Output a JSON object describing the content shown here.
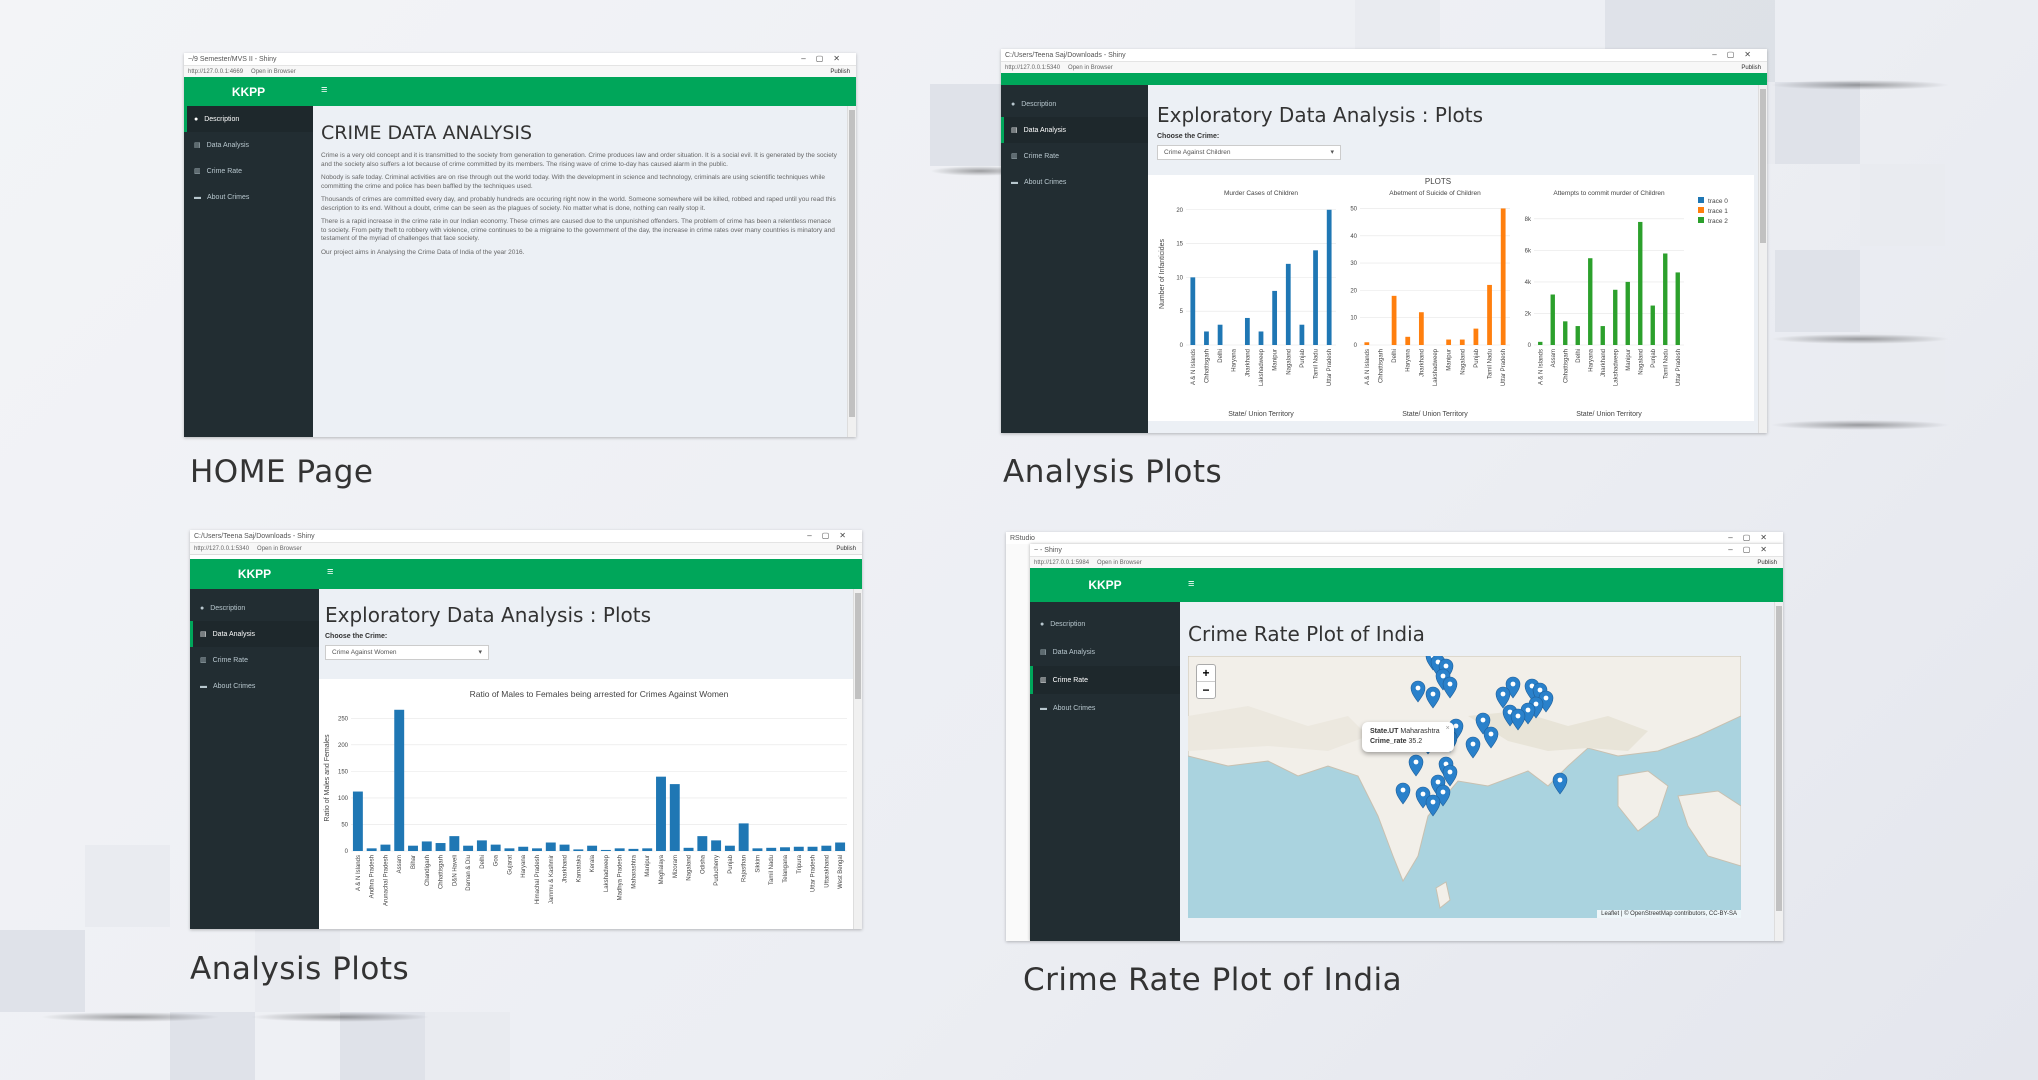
{
  "captions": {
    "home": "HOME Page",
    "analysis1": "Analysis Plots",
    "analysis2": "Analysis Plots",
    "map": "Crime Rate Plot of India"
  },
  "common": {
    "brand": "KKPP",
    "open_in_browser": "Open in Browser",
    "publish": "Publish",
    "nav": [
      "Description",
      "Data Analysis",
      "Crime Rate",
      "About Crimes"
    ]
  },
  "home": {
    "window_title": "~/9 Semester/MVS II - Shiny",
    "url": "http://127.0.0.1:4669",
    "heading": "CRIME DATA ANALYSIS",
    "paragraphs": [
      "Crime is a very old concept and it is transmitted to the society from generation to generation. Crime produces law and order situation. It is a social evil. It is generated by the society and the society also suffers a lot because of crime committed by its members. The rising wave of crime to-day has caused alarm in the public.",
      "Nobody is safe today. Criminal activities are on rise through out the world today. With the development in science and technology, criminals are using scientific techniques while committing the crime and police has been baffled by the techniques used.",
      "Thousands of crimes are committed every day, and probably hundreds are occuring right now in the world. Someone somewhere will be killed, robbed and raped until you read this description to its end. Without a doubt, crime can be seen as the plagues of society. No matter what is done, nothing can really stop it.",
      "There is a rapid increase in the crime rate in our Indian economy. These crimes are caused due to the unpunished offenders. The problem of crime has been a relentless menace to society. From petty theft to robbery with violence, crime continues to be a migraine to the government of the day, the increase in crime rates over many countries is minatory and testament of the myriad of challenges that face society.",
      "Our project aims in Analysing the Crime Data of India of the year 2016."
    ]
  },
  "analysis_children": {
    "window_title": "C:/Users/Teena Saj/Downloads - Shiny",
    "url": "http://127.0.0.1:5340",
    "heading": "Exploratory Data Analysis : Plots",
    "choose_label": "Choose the Crime:",
    "selected": "Crime Against Children",
    "plots_title": "PLOTS",
    "x_axis_label": "State/ Union Territory",
    "legend": [
      "trace 0",
      "trace 1",
      "trace 2"
    ],
    "colors": [
      "#1f77b4",
      "#ff7f0e",
      "#2ca02c"
    ]
  },
  "chart_data": [
    {
      "type": "bar",
      "title": "Murder Cases of Children",
      "ylabel": "Number of Infanticides",
      "ylim": [
        0,
        21
      ],
      "yticks": [
        0,
        5,
        10,
        15,
        20
      ],
      "categories": [
        "A & N Islands",
        "Chhattisgarh",
        "Delhi",
        "Haryana",
        "Jharkhand",
        "Lakshadweep",
        "Manipur",
        "Nagaland",
        "Punjab",
        "Tamil Nadu",
        "Uttar Pradesh"
      ],
      "series": [
        {
          "name": "trace 0",
          "values": [
            10,
            2,
            3,
            0,
            4,
            2,
            8,
            12,
            3,
            14,
            20
          ]
        }
      ]
    },
    {
      "type": "bar",
      "title": "Abetment of Suicide of Children",
      "ylim": [
        0,
        52
      ],
      "yticks": [
        0,
        10,
        20,
        30,
        40,
        50
      ],
      "categories": [
        "A & N Islands",
        "Chhattisgarh",
        "Delhi",
        "Haryana",
        "Jharkhand",
        "Lakshadweep",
        "Manipur",
        "Nagaland",
        "Punjab",
        "Tamil Nadu",
        "Uttar Pradesh"
      ],
      "series": [
        {
          "name": "trace 1",
          "values": [
            1,
            0,
            18,
            3,
            12,
            0,
            2,
            2,
            6,
            22,
            50
          ]
        }
      ]
    },
    {
      "type": "bar",
      "title": "Attempts to commit murder of Children",
      "ylim": [
        0,
        9000
      ],
      "yticks": [
        0,
        2000,
        4000,
        6000,
        8000
      ],
      "yticklabels": [
        "0",
        "2k",
        "4k",
        "6k",
        "8k"
      ],
      "categories": [
        "A & N Islands",
        "Assam",
        "Chhattisgarh",
        "Delhi",
        "Haryana",
        "Jharkhand",
        "Lakshadweep",
        "Manipur",
        "Nagaland",
        "Punjab",
        "Tamil Nadu",
        "Uttar Pradesh"
      ],
      "series": [
        {
          "name": "trace 2",
          "values": [
            200,
            3200,
            1500,
            1200,
            5500,
            1200,
            3500,
            4000,
            7800,
            2500,
            5800,
            4600
          ]
        }
      ]
    },
    {
      "type": "bar",
      "title": "Ratio of Males to Females being arrested for Crimes Against Women",
      "ylabel": "Ratio of Males and Females",
      "ylim": [
        0,
        275
      ],
      "yticks": [
        0,
        50,
        100,
        150,
        200,
        250
      ],
      "categories": [
        "A & N Islands",
        "Andhra Pradesh",
        "Arunachal Pradesh",
        "Assam",
        "Bihar",
        "Chandigarh",
        "Chhattisgarh",
        "D&N Haveli",
        "Daman & Diu",
        "Delhi",
        "Goa",
        "Gujarat",
        "Haryana",
        "Himachal Pradesh",
        "Jammu & Kashmir",
        "Jharkhand",
        "Karnataka",
        "Kerala",
        "Lakshadweep",
        "Madhya Pradesh",
        "Maharashtra",
        "Manipur",
        "Meghalaya",
        "Mizoram",
        "Nagaland",
        "Odisha",
        "Puducherry",
        "Punjab",
        "Rajasthan",
        "Sikkim",
        "Tamil Nadu",
        "Telangana",
        "Tripura",
        "Uttar Pradesh",
        "Uttarakhand",
        "West Bengal"
      ],
      "series": [
        {
          "name": "ratio",
          "values": [
            112,
            5,
            12,
            266,
            10,
            18,
            15,
            28,
            10,
            20,
            12,
            5,
            8,
            5,
            16,
            12,
            3,
            10,
            2,
            5,
            4,
            5,
            140,
            126,
            6,
            28,
            20,
            10,
            52,
            5,
            6,
            7,
            8,
            8,
            10,
            16
          ]
        }
      ]
    }
  ],
  "analysis_women": {
    "window_title": "C:/Users/Teena Saj/Downloads - Shiny",
    "url": "http://127.0.0.1:5340",
    "heading": "Exploratory Data Analysis : Plots",
    "choose_label": "Choose the Crime:",
    "selected": "Crime Against Women"
  },
  "map": {
    "outer_title": "RStudio",
    "window_title": "~ - Shiny",
    "url": "http://127.0.0.1:5984",
    "heading": "Crime Rate Plot of India",
    "zoom_in": "+",
    "zoom_out": "−",
    "popup_state_label": "State.UT",
    "popup_state_value": "Maharashtra",
    "popup_rate_label": "Crime_rate",
    "popup_rate_value": "35.2",
    "attribution": "Leaflet | © OpenStreetMap contributors, CC-BY-SA",
    "marker_color": "#2a81cb"
  }
}
